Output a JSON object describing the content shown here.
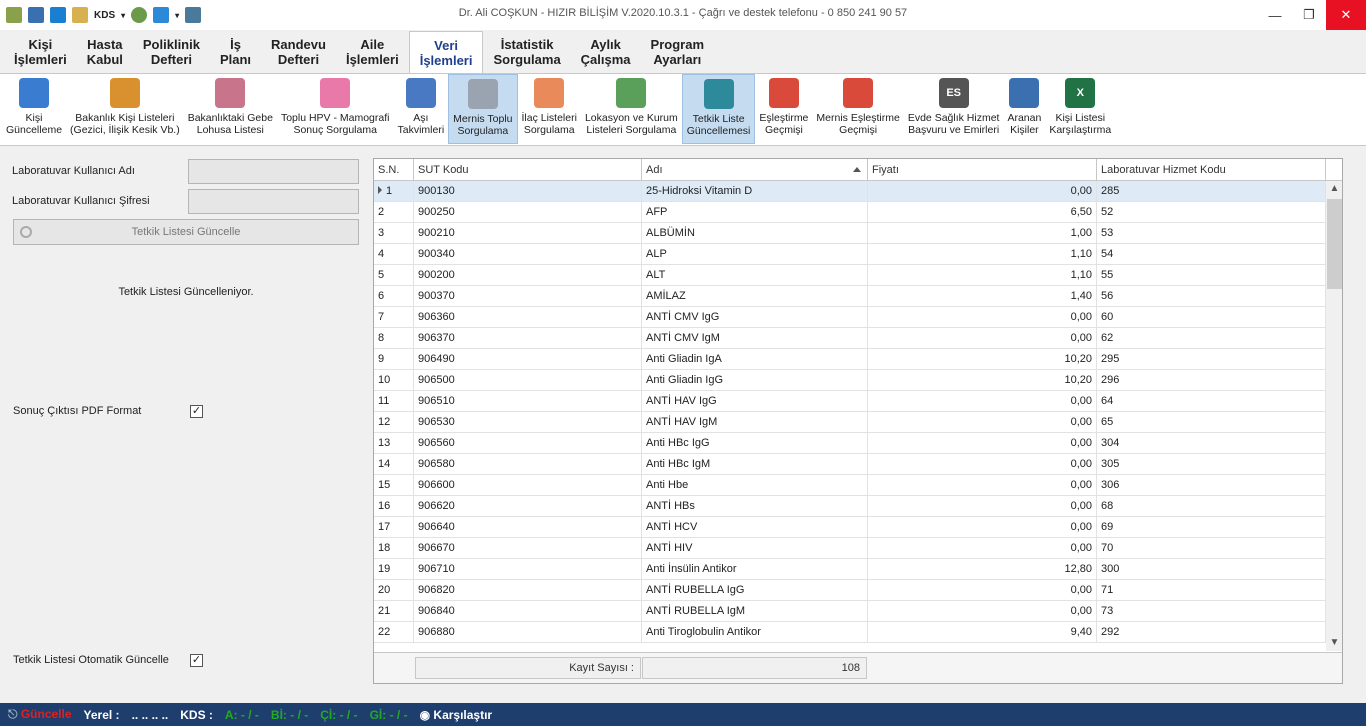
{
  "window": {
    "title": "Dr. Ali COŞKUN - HIZIR BİLİŞİM V.2020.10.3.1 - Çağrı ve destek telefonu - 0 850 241 90 57",
    "qat_kds": "KDS"
  },
  "tabs": [
    {
      "label": "Kişi\nİşlemleri"
    },
    {
      "label": "Hasta\nKabul"
    },
    {
      "label": "Poliklinik\nDefteri"
    },
    {
      "label": "İş\nPlanı"
    },
    {
      "label": "Randevu\nDefteri"
    },
    {
      "label": "Aile\nİşlemleri"
    },
    {
      "label": "Veri\nİşlemleri",
      "active": true
    },
    {
      "label": "İstatistik\nSorgulama"
    },
    {
      "label": "Aylık\nÇalışma"
    },
    {
      "label": "Program\nAyarları"
    }
  ],
  "ribbon": [
    {
      "label": "Kişi\nGüncelleme",
      "icon": "person-icon",
      "color": "#3a7ccf"
    },
    {
      "label": "Bakanlık Kişi Listeleri\n(Gezici, İlişik Kesik Vb.)",
      "icon": "people-group-icon",
      "color": "#d9902e"
    },
    {
      "label": "Bakanlıktaki Gebe\nLohusa Listesi",
      "icon": "pregnant-woman-icon",
      "color": "#c8748a"
    },
    {
      "label": "Toplu HPV - Mamografi\nSonuç Sorgulama",
      "icon": "pink-ribbon-icon",
      "color": "#e879a8"
    },
    {
      "label": "Aşı\nTakvimleri",
      "icon": "calendar-icon",
      "color": "#4a79c4"
    },
    {
      "label": "Mernis Toplu\nSorgulama",
      "icon": "document-search-icon",
      "color": "#9aa4b0",
      "active": true
    },
    {
      "label": "İlaç Listeleri\nSorgulama",
      "icon": "pill-icon",
      "color": "#e98a5a"
    },
    {
      "label": "Lokasyon ve Kurum\nListeleri Sorgulama",
      "icon": "map-icon",
      "color": "#5aa05a"
    },
    {
      "label": "Tetkik Liste\nGüncellemesi",
      "icon": "microscope-icon",
      "color": "#2d8a9a",
      "active": true
    },
    {
      "label": "Eşleştirme\nGeçmişi",
      "icon": "calendar-clock-icon",
      "color": "#d94a3a"
    },
    {
      "label": "Mernis Eşleştirme\nGeçmişi",
      "icon": "calendar-clock-icon",
      "color": "#d94a3a"
    },
    {
      "label": "Evde Sağlık Hizmet\nBaşvuru ve Emirleri",
      "icon": "es-document-icon",
      "color": "#555555",
      "text": "ES"
    },
    {
      "label": "Aranan\nKişiler",
      "icon": "eye-icon",
      "color": "#3a6fb0"
    },
    {
      "label": "Kişi Listesi\nKarşılaştırma",
      "icon": "excel-icon",
      "color": "#217346",
      "text": "X"
    }
  ],
  "left": {
    "user_label": "Laboratuvar Kullanıcı Adı",
    "pass_label": "Laboratuvar Kullanıcı Şifresi",
    "update_button": "Tetkik Listesi Güncelle",
    "status_text": "Tetkik Listesi Güncelleniyor.",
    "pdf_label": "Sonuç Çıktısı PDF Format",
    "auto_label": "Tetkik Listesi Otomatik Güncelle",
    "pdf_checked": true,
    "auto_checked": true
  },
  "grid": {
    "headers": [
      "S.N.",
      "SUT Kodu",
      "Adı",
      "Fiyatı",
      "Laboratuvar Hizmet Kodu"
    ],
    "rows": [
      [
        "1",
        "900130",
        "25-Hidroksi Vitamin D",
        "0,00",
        "285"
      ],
      [
        "2",
        "900250",
        "AFP",
        "6,50",
        "52"
      ],
      [
        "3",
        "900210",
        "ALBÜMİN",
        "1,00",
        "53"
      ],
      [
        "4",
        "900340",
        "ALP",
        "1,10",
        "54"
      ],
      [
        "5",
        "900200",
        "ALT",
        "1,10",
        "55"
      ],
      [
        "6",
        "900370",
        "AMİLAZ",
        "1,40",
        "56"
      ],
      [
        "7",
        "906360",
        "ANTİ CMV IgG",
        "0,00",
        "60"
      ],
      [
        "8",
        "906370",
        "ANTİ CMV IgM",
        "0,00",
        "62"
      ],
      [
        "9",
        "906490",
        "Anti Gliadin IgA",
        "10,20",
        "295"
      ],
      [
        "10",
        "906500",
        "Anti Gliadin IgG",
        "10,20",
        "296"
      ],
      [
        "11",
        "906510",
        "ANTİ HAV IgG",
        "0,00",
        "64"
      ],
      [
        "12",
        "906530",
        "ANTİ HAV IgM",
        "0,00",
        "65"
      ],
      [
        "13",
        "906560",
        "Anti HBc IgG",
        "0,00",
        "304"
      ],
      [
        "14",
        "906580",
        "Anti HBc IgM",
        "0,00",
        "305"
      ],
      [
        "15",
        "906600",
        "Anti Hbe",
        "0,00",
        "306"
      ],
      [
        "16",
        "906620",
        "ANTİ HBs",
        "0,00",
        "68"
      ],
      [
        "17",
        "906640",
        "ANTİ HCV",
        "0,00",
        "69"
      ],
      [
        "18",
        "906670",
        "ANTİ HIV",
        "0,00",
        "70"
      ],
      [
        "19",
        "906710",
        "Anti İnsülin Antikor",
        "12,80",
        "300"
      ],
      [
        "20",
        "906820",
        "ANTİ RUBELLA IgG",
        "0,00",
        "71"
      ],
      [
        "21",
        "906840",
        "ANTİ RUBELLA IgM",
        "0,00",
        "73"
      ],
      [
        "22",
        "906880",
        "Anti Tiroglobulin Antikor",
        "9,40",
        "292"
      ]
    ],
    "footer_label": "Kayıt Sayısı :",
    "footer_count": "108"
  },
  "statusbar": {
    "guncelle": "Güncelle",
    "yerel_label": "Yerel :",
    "yerel_value": "..  ..  ..  ..",
    "kds_label": "KDS :",
    "a": "A: - / -",
    "bi": "Bİ: - / -",
    "ci": "Çİ: - / -",
    "gi": "Gİ: - / -",
    "compare": "Karşılaştır"
  }
}
